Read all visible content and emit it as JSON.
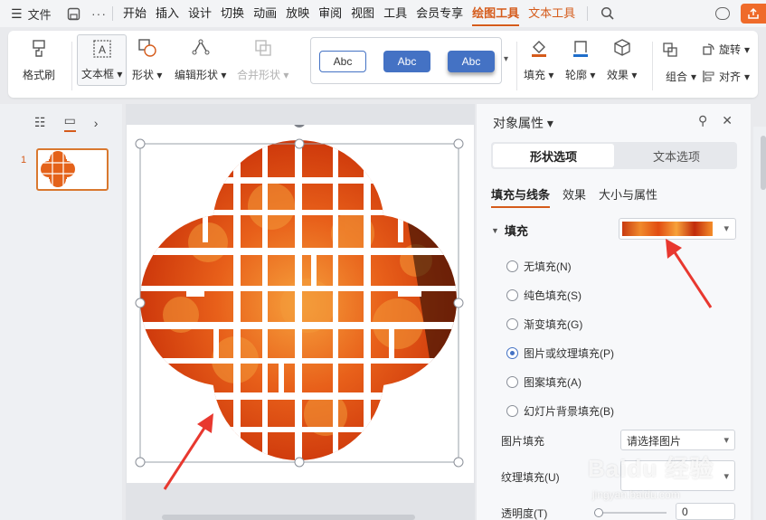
{
  "menubar": {
    "file_label": "文件",
    "tabs": [
      "开始",
      "插入",
      "设计",
      "切换",
      "动画",
      "放映",
      "审阅",
      "视图",
      "工具",
      "会员专享",
      "绘图工具",
      "文本工具"
    ],
    "active_tab": "绘图工具"
  },
  "ribbon": {
    "format_painter": "格式刷",
    "textbox": "文本框",
    "shape": "形状",
    "edit_shape": "编辑形状",
    "merge_shape": "合并形状",
    "styles": [
      "Abc",
      "Abc",
      "Abc"
    ],
    "fill": "填充",
    "outline": "轮廓",
    "effect": "效果",
    "group": "组合",
    "rotate": "旋转",
    "align": "对齐"
  },
  "slides": {
    "current_index": "1"
  },
  "panel": {
    "title": "对象属性",
    "segments": [
      "形状选项",
      "文本选项"
    ],
    "subtabs": [
      "填充与线条",
      "效果",
      "大小与属性"
    ],
    "fill_header": "填充",
    "fill_options": [
      {
        "label": "无填充(N)",
        "selected": false
      },
      {
        "label": "纯色填充(S)",
        "selected": false
      },
      {
        "label": "渐变填充(G)",
        "selected": false
      },
      {
        "label": "图片或纹理填充(P)",
        "selected": true
      },
      {
        "label": "图案填充(A)",
        "selected": false
      },
      {
        "label": "幻灯片背景填充(B)",
        "selected": false
      }
    ],
    "picture_fill_label": "图片填充",
    "picture_fill_value": "请选择图片",
    "texture_fill_label": "纹理填充(U)",
    "transparency_label": "透明度(T)",
    "transparency_value": "0"
  },
  "colors": {
    "accent": "#d55b1b",
    "style_blue": "#4472c4",
    "arrow_red": "#e8382f"
  },
  "watermark": {
    "main": "Baidu 经验",
    "sub": "jingyan.baidu.com"
  }
}
